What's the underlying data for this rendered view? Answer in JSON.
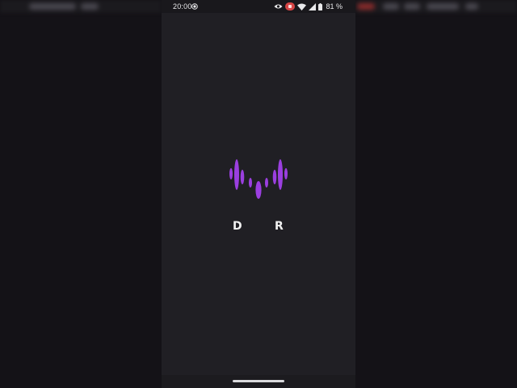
{
  "status_bar": {
    "time": "20:00",
    "battery_percent": "81 %",
    "icons": [
      "record-icon",
      "eye-icon",
      "notification-badge-icon",
      "wifi-icon",
      "signal-icon",
      "battery-icon"
    ]
  },
  "splash": {
    "logo_icon": "sound-wave-logo-icon",
    "letter_left": "D",
    "letter_right": "R",
    "logo_color": "#9b3fe0"
  },
  "colors": {
    "screen_background": "#201f24",
    "side_background": "#141217",
    "status_text": "#e8e8ea"
  }
}
